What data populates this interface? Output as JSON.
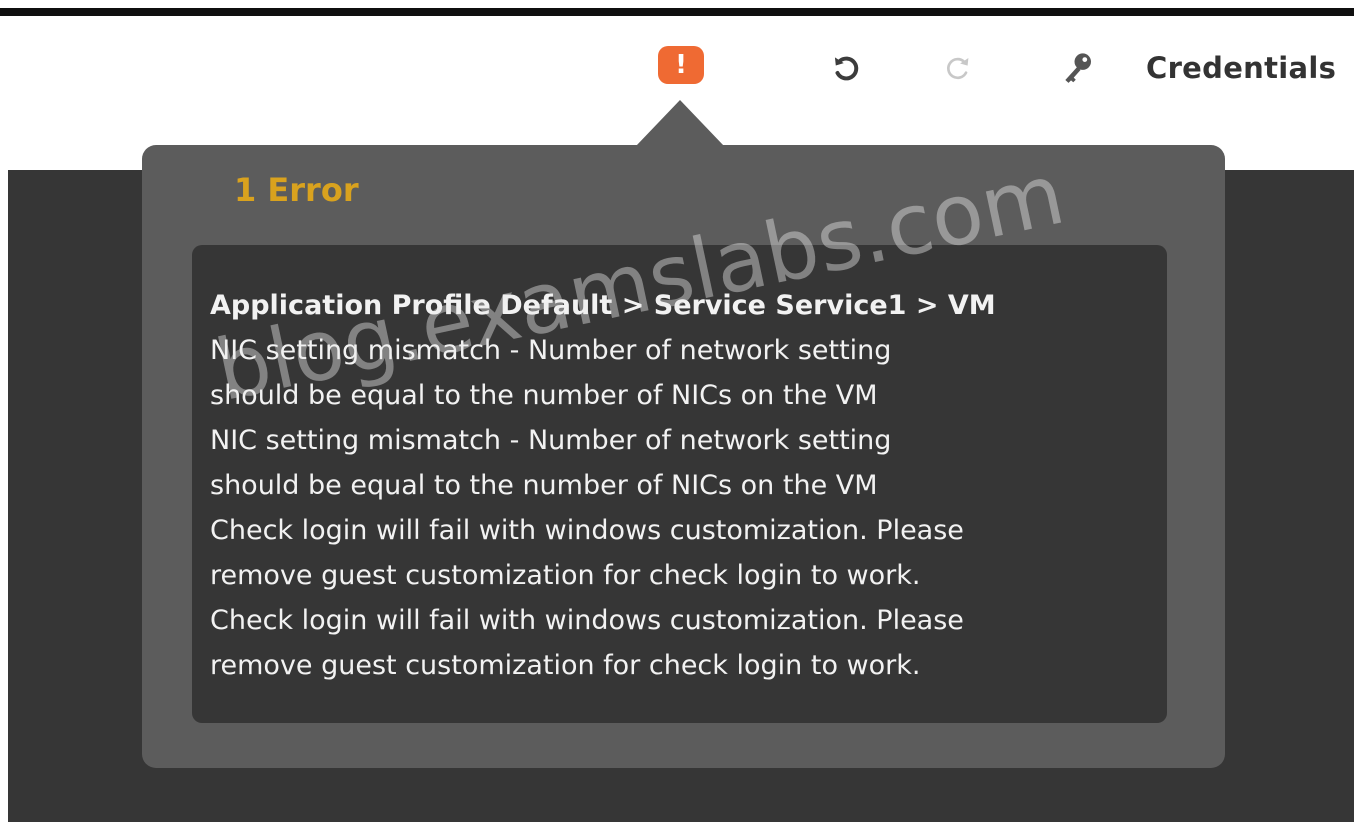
{
  "toolbar": {
    "error_indicator": "!",
    "undo_icon": "undo-icon",
    "redo_icon": "redo-icon",
    "key_icon": "key-icon",
    "credentials_label": "Credentials"
  },
  "popover": {
    "title": "1 Error",
    "lines": [
      "Application Profile Default > Service Service1 > VM",
      "NIC setting mismatch - Number of network setting",
      "should be equal to the number of NICs on the VM",
      "NIC setting mismatch - Number of network setting",
      "should be equal to the number of NICs on the VM",
      "Check login will fail with windows customization. Please",
      "remove guest customization for check login to work.",
      "Check login will fail with windows customization. Please",
      "remove guest customization for check login to work."
    ]
  },
  "watermark": "blog.examslabs.com",
  "colors": {
    "error_accent": "#ef6a33",
    "title": "#d9a21e",
    "popover_bg": "#5c5c5c",
    "panel_bg": "#363636",
    "text": "#f2f2f2"
  }
}
